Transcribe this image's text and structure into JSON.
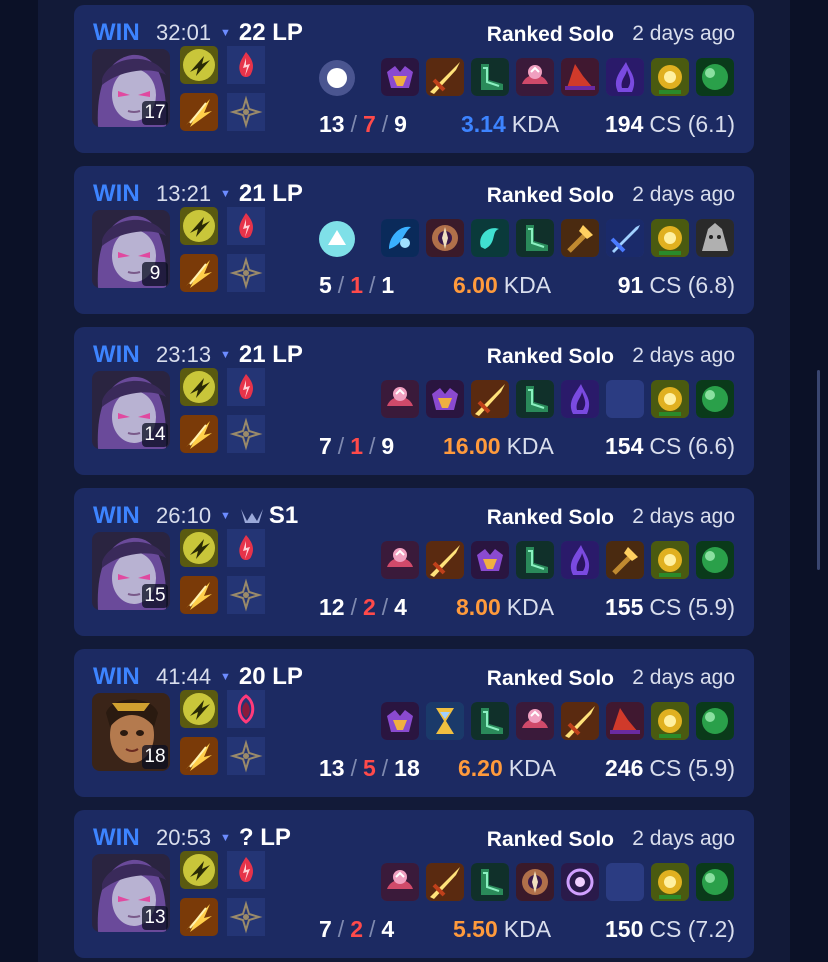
{
  "colors": {
    "win": "#3d84ff",
    "kda_blue": "#3d84ff",
    "kda_orange": "#ff9a3c",
    "deaths_red": "#ff4a4a",
    "card_bg": "#1c2a62"
  },
  "matches": [
    {
      "result": "WIN",
      "duration": "32:01",
      "lp": "22 LP",
      "queue": "Ranked Solo",
      "time_ago": "2 days ago",
      "champion": "vex",
      "level": "17",
      "spells": [
        "ghost-icon",
        "flash-icon"
      ],
      "runes": [
        "electrocute-icon",
        "sorcery-icon"
      ],
      "ward": "oracle-lens-icon",
      "items": [
        "dark-seal-icon",
        "sword-icon",
        "boots-icon",
        "lich-bane-icon",
        "hat-icon",
        "shadow-flame-icon",
        "gold-orb-icon",
        "green-orb-icon"
      ],
      "kills": "13",
      "deaths": "7",
      "assists": "9",
      "kda": "3.14",
      "kda_label": "KDA",
      "kda_color": "blue",
      "cs": "194",
      "cs_label": "CS",
      "cs_rate": "(6.1)"
    },
    {
      "result": "WIN",
      "duration": "13:21",
      "lp": "21 LP",
      "queue": "Ranked Solo",
      "time_ago": "2 days ago",
      "champion": "vex",
      "level": "9",
      "spells": [
        "ghost-icon",
        "flash-icon"
      ],
      "runes": [
        "electrocute-icon",
        "sorcery-icon"
      ],
      "ward": "farsight-icon",
      "items": [
        "blue-orb-icon",
        "compass-icon",
        "teal-orb-icon",
        "boots-icon",
        "wand-icon",
        "blade-icon",
        "gold-orb-icon",
        "ghost-hat-icon"
      ],
      "kills": "5",
      "deaths": "1",
      "assists": "1",
      "kda": "6.00",
      "kda_label": "KDA",
      "kda_color": "orange",
      "cs": "91",
      "cs_label": "CS",
      "cs_rate": "(6.8)"
    },
    {
      "result": "WIN",
      "duration": "23:13",
      "lp": "21 LP",
      "queue": "Ranked Solo",
      "time_ago": "2 days ago",
      "champion": "vex",
      "level": "14",
      "spells": [
        "ghost-icon",
        "flash-icon"
      ],
      "runes": [
        "electrocute-icon",
        "sorcery-icon"
      ],
      "ward": "",
      "items": [
        "lich-bane-icon",
        "dark-seal-icon",
        "sword-icon",
        "boots-icon",
        "shadow-flame-icon",
        "",
        "gold-orb-icon",
        "green-orb-icon"
      ],
      "kills": "7",
      "deaths": "1",
      "assists": "9",
      "kda": "16.00",
      "kda_label": "KDA",
      "kda_color": "orange",
      "cs": "154",
      "cs_label": "CS",
      "cs_rate": "(6.6)"
    },
    {
      "result": "WIN",
      "duration": "26:10",
      "lp": "S1",
      "queue": "Ranked Solo",
      "time_ago": "2 days ago",
      "lp_icon": true,
      "champion": "vex",
      "level": "15",
      "spells": [
        "ghost-icon",
        "flash-icon"
      ],
      "runes": [
        "electrocute-icon",
        "sorcery-icon"
      ],
      "ward": "",
      "items": [
        "lich-bane-icon",
        "sword-icon",
        "dark-seal-icon",
        "boots-icon",
        "shadow-flame-icon",
        "wand-icon",
        "gold-orb-icon",
        "green-orb-icon"
      ],
      "kills": "12",
      "deaths": "2",
      "assists": "4",
      "kda": "8.00",
      "kda_label": "KDA",
      "kda_color": "orange",
      "cs": "155",
      "cs_label": "CS",
      "cs_rate": "(5.9)"
    },
    {
      "result": "WIN",
      "duration": "41:44",
      "lp": "20 LP",
      "queue": "Ranked Solo",
      "time_ago": "2 days ago",
      "champion": "qiyana",
      "level": "18",
      "spells": [
        "ghost-icon",
        "flash-icon"
      ],
      "runes": [
        "conqueror-icon",
        "sorcery-icon"
      ],
      "ward": "",
      "items": [
        "dark-seal-icon",
        "hourglass-icon",
        "boots-icon",
        "lich-bane-icon",
        "sword-icon",
        "hat-icon",
        "gold-orb-icon",
        "green-orb-icon"
      ],
      "kills": "13",
      "deaths": "5",
      "assists": "18",
      "kda": "6.20",
      "kda_label": "KDA",
      "kda_color": "orange",
      "cs": "246",
      "cs_label": "CS",
      "cs_rate": "(5.9)"
    },
    {
      "result": "WIN",
      "duration": "20:53",
      "lp": "? LP",
      "queue": "Ranked Solo",
      "time_ago": "2 days ago",
      "champion": "vex",
      "level": "13",
      "spells": [
        "ghost-icon",
        "flash-icon"
      ],
      "runes": [
        "electrocute-icon",
        "sorcery-icon"
      ],
      "ward": "",
      "items": [
        "lich-bane-icon",
        "sword-icon",
        "boots-icon",
        "compass-icon",
        "purple-orb-icon",
        "",
        "gold-orb-icon",
        "green-orb-icon"
      ],
      "kills": "7",
      "deaths": "2",
      "assists": "4",
      "kda": "5.50",
      "kda_label": "KDA",
      "kda_color": "orange",
      "cs": "150",
      "cs_label": "CS",
      "cs_rate": "(7.2)"
    }
  ]
}
